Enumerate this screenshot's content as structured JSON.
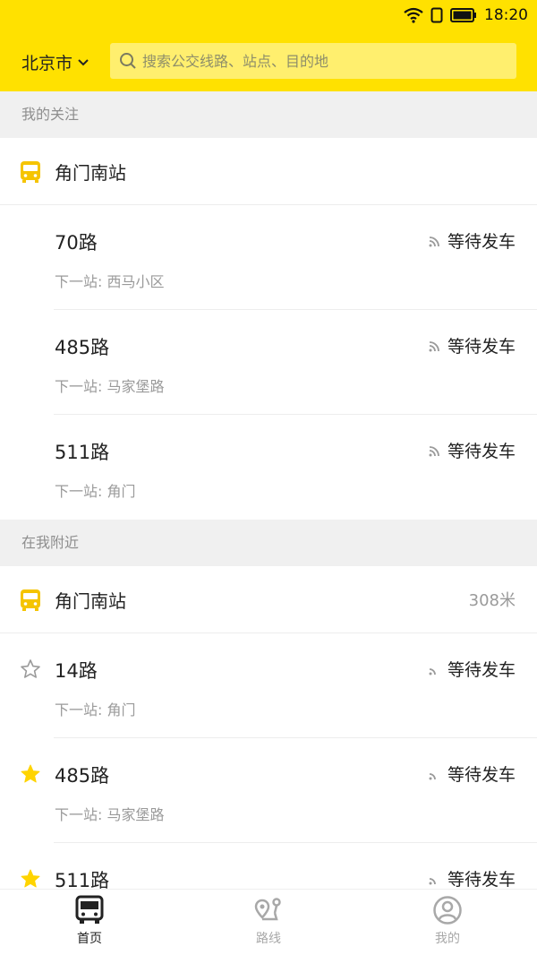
{
  "status": {
    "time": "18:20"
  },
  "header": {
    "city": "北京市",
    "search_placeholder": "搜索公交线路、站点、目的地"
  },
  "following": {
    "title": "我的关注",
    "station": "角门南站",
    "routes": [
      {
        "name": "70路",
        "next": "下一站: 西马小区",
        "status": "等待发车"
      },
      {
        "name": "485路",
        "next": "下一站: 马家堡路",
        "status": "等待发车"
      },
      {
        "name": "511路",
        "next": "下一站: 角门",
        "status": "等待发车"
      }
    ]
  },
  "nearby": {
    "title": "在我附近",
    "station": "角门南站",
    "distance": "308米",
    "routes": [
      {
        "name": "14路",
        "next": "下一站: 角门",
        "status": "等待发车",
        "starred": false
      },
      {
        "name": "485路",
        "next": "下一站: 马家堡路",
        "status": "等待发车",
        "starred": true
      },
      {
        "name": "511路",
        "next": "",
        "status": "等待发车",
        "starred": true
      }
    ]
  },
  "tabs": [
    {
      "label": "首页",
      "icon": "bus-icon",
      "active": true
    },
    {
      "label": "路线",
      "icon": "route-map-icon",
      "active": false
    },
    {
      "label": "我的",
      "icon": "profile-icon",
      "active": false
    }
  ],
  "colors": {
    "brand": "#FFE100",
    "search_bg": "#FFEF6E",
    "accent_icon": "#F5C400",
    "muted": "#9A9A9A"
  }
}
